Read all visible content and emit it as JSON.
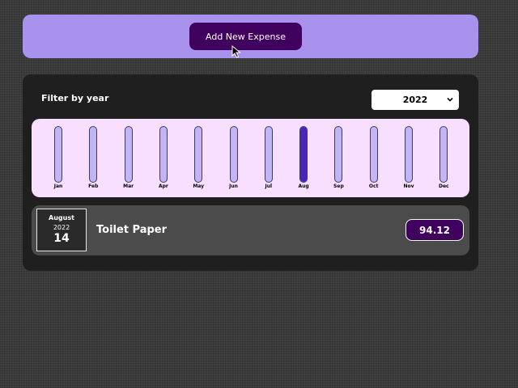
{
  "new_expense": {
    "add_button_label": "Add New Expense"
  },
  "filter": {
    "label": "Filter by year",
    "selected_year": "2022"
  },
  "chart_data": {
    "type": "bar",
    "categories": [
      "Jan",
      "Feb",
      "Mar",
      "Apr",
      "May",
      "Jun",
      "Jul",
      "Aug",
      "Sep",
      "Oct",
      "Nov",
      "Dec"
    ],
    "values": [
      0,
      0,
      0,
      0,
      0,
      0,
      0,
      94.12,
      0,
      0,
      0,
      0
    ],
    "ylim": [
      0,
      94.12
    ]
  },
  "expenses": [
    {
      "month": "August",
      "year": "2022",
      "day": "14",
      "title": "Toilet Paper",
      "amount": "94.12"
    }
  ],
  "colors": {
    "panel_purple": "#a892ee",
    "button_dark_purple": "#40005d",
    "chart_background": "#f8dfff",
    "bar_empty": "#c3b4f3",
    "bar_fill": "#4826b9",
    "list_background": "#1f1f1f",
    "item_background": "#4b4b4b"
  },
  "icons": {
    "cursor": "mouse-pointer-icon",
    "select": "chevron-down-icon"
  }
}
